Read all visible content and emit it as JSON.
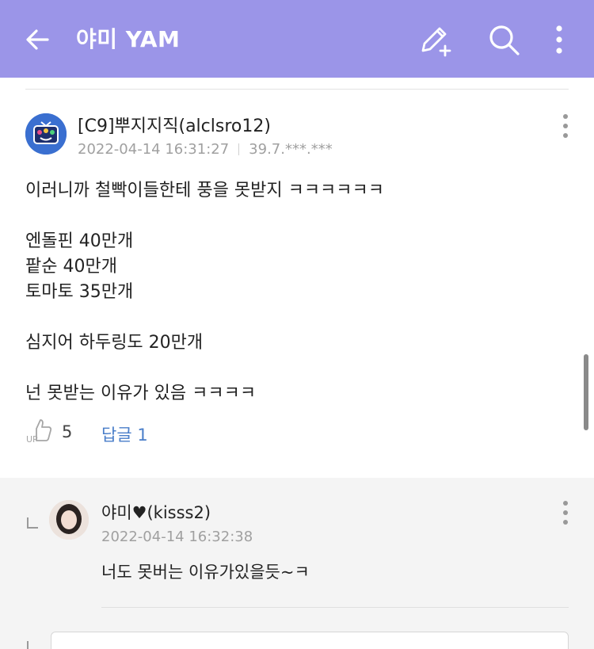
{
  "header": {
    "title": "야미 YAM",
    "back_icon": "arrow-left-icon",
    "write_icon": "pencil-plus-icon",
    "search_icon": "search-icon",
    "more_icon": "vertical-dots-icon",
    "background": "#9b95e8"
  },
  "comment": {
    "author": "[C9]뿌지지직(alclsro12)",
    "date": "2022-04-14 16:31:27",
    "ip": "39.7.***.***",
    "body_lines": [
      "이러니까 철빡이들한테 풍을 못받지 ㅋㅋㅋㅋㅋㅋ",
      "",
      "엔돌핀 40만개",
      "팥순 40만개",
      "토마토 35만개",
      "",
      "심지어 하두링도 20만개",
      "",
      "넌 못받는 이유가 있음 ㅋㅋㅋㅋ"
    ],
    "like_label": "UP",
    "like_count": "5",
    "reply_label": "답글",
    "reply_count": "1",
    "accent": "#4a7ec9"
  },
  "reply": {
    "author": "야미♥(kisss2)",
    "date": "2022-04-14 16:32:38",
    "text": "너도 못버는 이유가있을듯~ㅋ"
  }
}
